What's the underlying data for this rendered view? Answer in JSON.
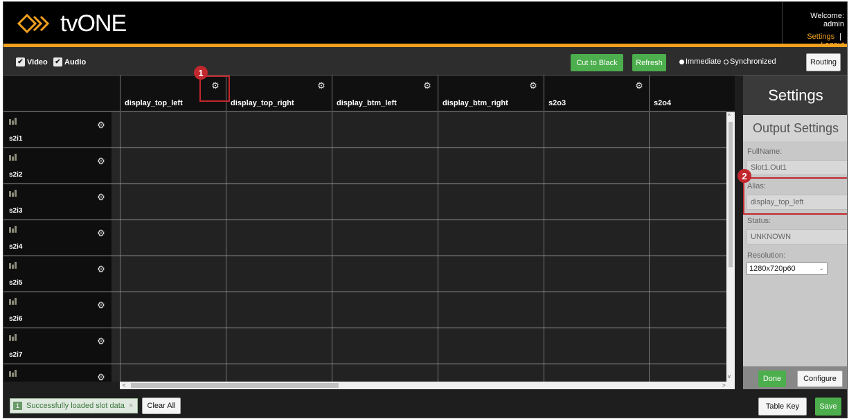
{
  "header": {
    "logo_text": "tvONE",
    "welcome": "Welcome: admin",
    "settings_link": "Settings",
    "separator": "|",
    "logout_link": "Logout",
    "accent_color": "#f0a01e"
  },
  "toolbar": {
    "video_label": "Video",
    "audio_label": "Audio",
    "video_checked": true,
    "audio_checked": true,
    "cut_to_black_label": "Cut to Black",
    "refresh_label": "Refresh",
    "immediate_label": "Immediate",
    "synchronized_label": "Synchronized",
    "selected_mode": "Immediate",
    "routing_label": "Routing"
  },
  "grid": {
    "columns": [
      {
        "label": "display_top_left"
      },
      {
        "label": "display_top_right"
      },
      {
        "label": "display_btm_left"
      },
      {
        "label": "display_btm_right"
      },
      {
        "label": "s2o3"
      },
      {
        "label": "s2o4"
      }
    ],
    "rows": [
      {
        "label": "s2i1"
      },
      {
        "label": "s2i2"
      },
      {
        "label": "s2i3"
      },
      {
        "label": "s2i4"
      },
      {
        "label": "s2i5"
      },
      {
        "label": "s2i6"
      },
      {
        "label": "s2i7"
      },
      {
        "label": ""
      }
    ]
  },
  "panel": {
    "title": "Settings",
    "subtitle": "Output Settings",
    "fullname_label": "FullName:",
    "fullname_value": "Slot1.Out1",
    "alias_label": "Alias:",
    "alias_value": "display_top_left",
    "status_label": "Status:",
    "status_value": "UNKNOWN",
    "resolution_label": "Resolution:",
    "resolution_value": "1280x720p60",
    "done_label": "Done",
    "configure_label": "Configure"
  },
  "footer": {
    "toast_count": "1",
    "toast_text": "Successfully loaded slot data",
    "toast_close": "×",
    "clear_all_label": "Clear All",
    "table_key_label": "Table Key",
    "save_label": "Save"
  },
  "annotations": {
    "badge_1": "1",
    "badge_2": "2"
  }
}
